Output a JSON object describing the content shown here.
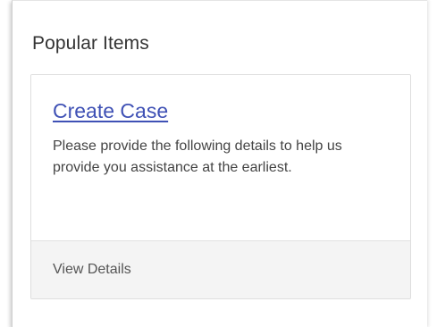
{
  "panel": {
    "title": "Popular Items"
  },
  "card": {
    "title": "Create Case",
    "description": "Please provide the following details to help us provide you assistance at the earliest.",
    "footer_link": "View Details"
  }
}
